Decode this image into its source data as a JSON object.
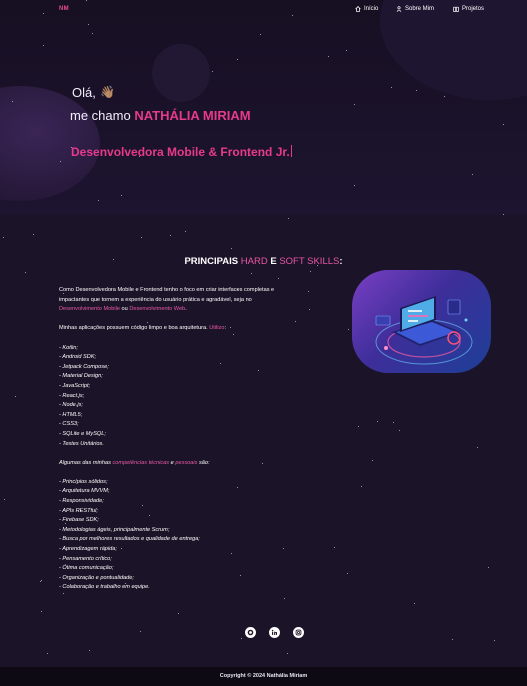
{
  "nav": {
    "logo": "NM",
    "items": [
      {
        "label": "Início",
        "icon": "home-icon"
      },
      {
        "label": "Sobre Mim",
        "icon": "user-icon"
      },
      {
        "label": "Projetos",
        "icon": "book-icon"
      }
    ]
  },
  "hero": {
    "greeting": "Olá,",
    "wave_emoji": "👋🏽",
    "intro_prefix": "me chamo",
    "name": "NATHÁLIA MIRIAM",
    "role": "Desenvolvedora Mobile & Frontend Jr."
  },
  "skills_title": {
    "part1": "PRINCIPAIS",
    "hard": "HARD",
    "e": "E",
    "soft": "SOFT SKILLS",
    "colon": ":"
  },
  "about": {
    "p1_start": "Como Desenvolvedora Mobile e Frontend tenho o foco em criar interfaces completas e",
    "p1_line2": "impactantes que tornem a experiência do usuário prática e agradável, seja no",
    "link_mobile": "Desenvolvimento Mobile",
    "or": "ou",
    "link_web": "Desenvolvimento Web",
    "p1_end": ".",
    "p2_start": "Minhas aplicações possuem código limpo e boa arquitetura.",
    "p2_link": "Utilizo",
    "p2_end": ":"
  },
  "hard_skills": [
    "- Kotlin;",
    "- Android SDK;",
    "- Jetpack Compose;",
    "- Material Design;",
    "- JavaScript;",
    "- React.js;",
    "- Node.js;",
    "- HTML5;",
    "- CSS3;",
    "- SQLite e MySQL;",
    "- Testes Unitários."
  ],
  "soft_intro": {
    "start": "Algumas das minhas",
    "link1": "competências técnicas",
    "e": "e",
    "link2": "pessoais",
    "end": "são:"
  },
  "soft_skills": [
    "- Princípios sólidos;",
    "- Arquitetura MVVM;",
    "- Responsividade;",
    "- APIs RESTful;",
    "- Firebase SDK;",
    "- Metodologias ágeis, principalmente Scrum;",
    "- Busca por melhores resultados e qualidade de entrega;",
    "- Aprendizagem rápida;",
    "- Pensamento crítico;",
    "- Ótima comunicação;",
    "- Organização e pontualidade;",
    "- Colaboração e trabalho em equipe."
  ],
  "social": [
    {
      "icon": "github-icon"
    },
    {
      "icon": "linkedin-icon"
    },
    {
      "icon": "instagram-icon"
    }
  ],
  "footer": {
    "copyright": "Copyright © 2024 Nathália Miriam"
  },
  "colors": {
    "accent": "#e73a8c",
    "background": "#1b1328",
    "footer": "#0e0a14"
  }
}
